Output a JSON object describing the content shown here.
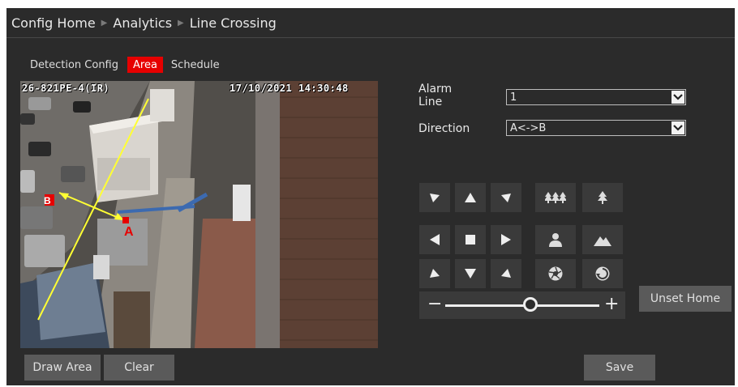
{
  "breadcrumb": {
    "home": "Config Home",
    "analytics": "Analytics",
    "current": "Line Crossing"
  },
  "tabs": [
    {
      "label": "Detection Config",
      "active": false
    },
    {
      "label": "Area",
      "active": true
    },
    {
      "label": "Schedule",
      "active": false
    }
  ],
  "video": {
    "camera_name": "26-821PE-4(IR)",
    "timestamp": "17/10/2021 14:30:48",
    "point_a": "A",
    "point_b": "B"
  },
  "form": {
    "alarm_line_label": "Alarm\nLine",
    "alarm_line_value": "1",
    "direction_label": "Direction",
    "direction_value": "A<->B"
  },
  "ptz": {
    "zoom_minus": "−",
    "zoom_plus": "+",
    "zoom_level": 0.55,
    "icons": [
      "arrow-up-left",
      "arrow-up",
      "arrow-up-right",
      "zoom-out-trees",
      "zoom-in-tree",
      "arrow-left",
      "stop",
      "arrow-right",
      "person",
      "mountain",
      "arrow-down-left",
      "arrow-down",
      "arrow-down-right",
      "focus-iris",
      "refresh"
    ]
  },
  "buttons": {
    "unset_home": "Unset Home",
    "draw_area": "Draw Area",
    "clear": "Clear",
    "save": "Save"
  },
  "colors": {
    "accent": "#e60000",
    "background": "#2b2b2b",
    "line": "#ffff33",
    "arrow": "#ffff33",
    "marker": "#e60000"
  }
}
